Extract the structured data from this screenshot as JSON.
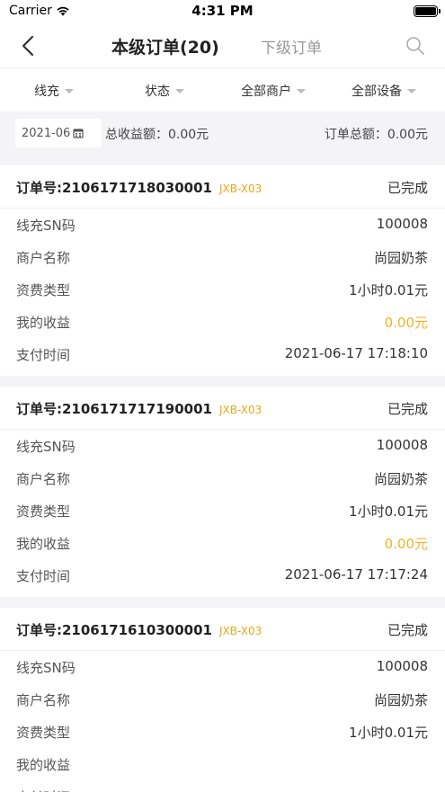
{
  "status_bar": {
    "carrier": "Carrier",
    "time": "4:31 PM"
  },
  "nav": {
    "title": "本级订单(20)",
    "sub_tab": "下级订单"
  },
  "filters": [
    {
      "label": "线充"
    },
    {
      "label": "状态"
    },
    {
      "label": "全部商户"
    },
    {
      "label": "全部设备"
    }
  ],
  "summary": {
    "date": "2021-06",
    "total_income": "总收益额：0.00元",
    "order_total": "订单总额：0.00元"
  },
  "labels": {
    "sn": "线充SN码",
    "merchant": "商户名称",
    "fee_type": "资费类型",
    "income": "我的收益",
    "pay_time": "支付时间"
  },
  "orders": [
    {
      "order_no": "订单号:2106171718030001",
      "tag": "JXB-X03",
      "status": "已完成",
      "sn": "100008",
      "merchant": "尚园奶茶",
      "fee_type": "1小时0.01元",
      "income": "0.00元",
      "pay_time": "2021-06-17 17:18:10"
    },
    {
      "order_no": "订单号:2106171717190001",
      "tag": "JXB-X03",
      "status": "已完成",
      "sn": "100008",
      "merchant": "尚园奶茶",
      "fee_type": "1小时0.01元",
      "income": "0.00元",
      "pay_time": "2021-06-17 17:17:24"
    },
    {
      "order_no": "订单号:2106171610300001",
      "tag": "JXB-X03",
      "status": "已完成",
      "sn": "100008",
      "merchant": "尚园奶茶",
      "fee_type": "1小时0.01元",
      "income": "",
      "pay_time": ""
    }
  ]
}
